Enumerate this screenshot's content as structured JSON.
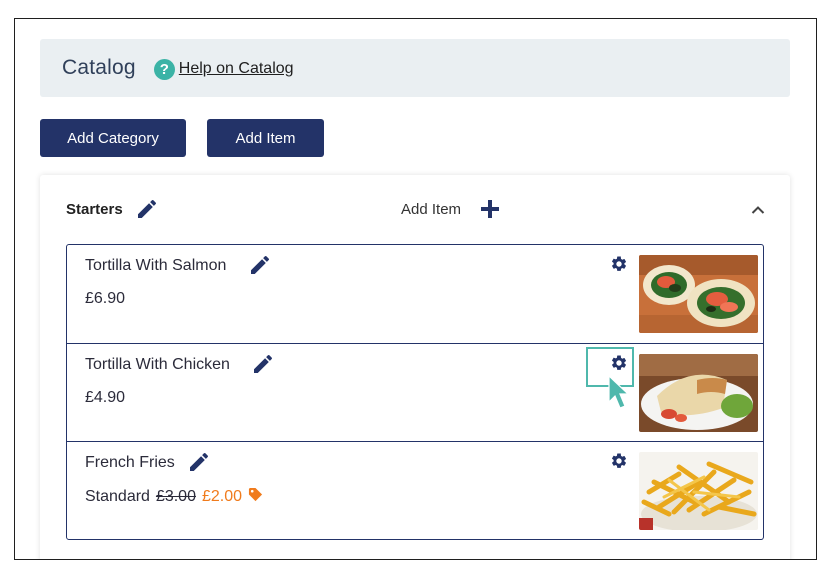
{
  "header": {
    "title": "Catalog",
    "help_icon": "question-circle-icon",
    "help_label": "Help on Catalog"
  },
  "toolbar": {
    "add_category_label": "Add Category",
    "add_item_label": "Add Item"
  },
  "category": {
    "name": "Starters",
    "add_item_label": "Add Item",
    "collapse_icon": "chevron-up-icon",
    "items": [
      {
        "name": "Tortilla With Salmon",
        "price": "£6.90",
        "image": "salmon-tortilla-photo"
      },
      {
        "name": "Tortilla With Chicken",
        "price": "£4.90",
        "image": "chicken-tortilla-photo"
      },
      {
        "name": "French Fries",
        "variant": "Standard",
        "old_price": "£3.00",
        "new_price": "£2.00",
        "image": "french-fries-photo"
      }
    ]
  },
  "colors": {
    "primary": "#233368",
    "accent_teal": "#3bb3a6",
    "discount_orange": "#f07b1c",
    "header_bg": "#eaeff2"
  }
}
